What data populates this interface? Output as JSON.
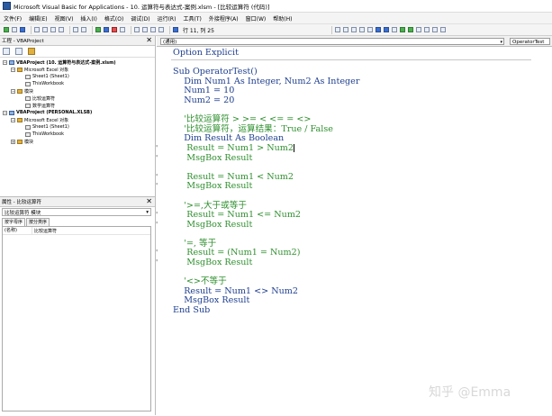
{
  "window": {
    "title": "Microsoft Visual Basic for Applications - 10. 运算符与表达式-案例.xlsm - [比较运算符 (代码)]"
  },
  "menu": [
    "文件(F)",
    "编辑(E)",
    "视图(V)",
    "插入(I)",
    "格式(O)",
    "调试(D)",
    "运行(R)",
    "工具(T)",
    "外接程序(A)",
    "窗口(W)",
    "帮助(H)"
  ],
  "toolbar": {
    "position": "行 11, 列 25"
  },
  "project": {
    "title": "工程 - VBAProject",
    "nodes": [
      {
        "level": 0,
        "box": "−",
        "icon": "proj",
        "label": "VBAProject (10. 运算符与表达式-案例.xlsm)"
      },
      {
        "level": 1,
        "box": "−",
        "icon": "folder",
        "label": "Microsoft Excel 对象"
      },
      {
        "level": 2,
        "box": "",
        "icon": "doc",
        "label": "Sheet1 (Sheet1)"
      },
      {
        "level": 2,
        "box": "",
        "icon": "doc",
        "label": "ThisWorkbook"
      },
      {
        "level": 1,
        "box": "−",
        "icon": "folder",
        "label": "模块"
      },
      {
        "level": 2,
        "box": "",
        "icon": "doc",
        "label": "比较运算符"
      },
      {
        "level": 2,
        "box": "",
        "icon": "doc",
        "label": "数学运算符"
      },
      {
        "level": 0,
        "box": "−",
        "icon": "proj",
        "label": "VBAProject (PERSONAL.XLSB)"
      },
      {
        "level": 1,
        "box": "−",
        "icon": "folder",
        "label": "Microsoft Excel 对象"
      },
      {
        "level": 2,
        "box": "",
        "icon": "doc",
        "label": "Sheet1 (Sheet1)"
      },
      {
        "level": 2,
        "box": "",
        "icon": "doc",
        "label": "ThisWorkbook"
      },
      {
        "level": 1,
        "box": "+",
        "icon": "folder",
        "label": "模块"
      }
    ]
  },
  "properties": {
    "title": "属性 - 比较运算符",
    "selector": "比较运算符 模块",
    "tabs": [
      "按字母序",
      "按分类序"
    ],
    "rows": [
      {
        "key": "(名称)",
        "value": "比较运算符"
      }
    ]
  },
  "code_window": {
    "object_combo": "(通用)",
    "proc_combo": "OperatorTest",
    "lines": [
      {
        "t": "Option Explicit",
        "c": "kw",
        "m": ""
      },
      {
        "t": "",
        "c": "kw",
        "m": ""
      },
      {
        "t": "Sub OperatorTest()",
        "c": "kw",
        "m": ""
      },
      {
        "t": "    Dim Num1 As Integer, Num2 As Integer",
        "c": "kw",
        "m": ""
      },
      {
        "t": "    Num1 = 10",
        "c": "kw",
        "m": ""
      },
      {
        "t": "    Num2 = 20",
        "c": "kw",
        "m": ""
      },
      {
        "t": "",
        "c": "kw",
        "m": ""
      },
      {
        "t": "    '比较运算符 > >= < <= = <>",
        "c": "cm",
        "m": ""
      },
      {
        "t": "    '比较运算符，运算结果：True / False",
        "c": "cm",
        "m": ""
      },
      {
        "t": "    Dim Result As Boolean",
        "c": "kw",
        "m": ""
      },
      {
        "t": "     Result = Num1 > Num2",
        "c": "cm",
        "m": "'"
      },
      {
        "t": "     MsgBox Result",
        "c": "cm",
        "m": "'"
      },
      {
        "t": "",
        "c": "kw",
        "m": ""
      },
      {
        "t": "     Result = Num1 < Num2",
        "c": "cm",
        "m": "'"
      },
      {
        "t": "     MsgBox Result",
        "c": "cm",
        "m": "'"
      },
      {
        "t": "",
        "c": "kw",
        "m": ""
      },
      {
        "t": "    '>=,大于或等于",
        "c": "cm",
        "m": ""
      },
      {
        "t": "     Result = Num1 <= Num2",
        "c": "cm",
        "m": "'"
      },
      {
        "t": "     MsgBox Result",
        "c": "cm",
        "m": "'"
      },
      {
        "t": "",
        "c": "kw",
        "m": ""
      },
      {
        "t": "    '=, 等于",
        "c": "cm",
        "m": ""
      },
      {
        "t": "     Result = (Num1 = Num2)",
        "c": "cm",
        "m": "'"
      },
      {
        "t": "     MsgBox Result",
        "c": "cm",
        "m": "'"
      },
      {
        "t": "",
        "c": "kw",
        "m": ""
      },
      {
        "t": "    '<>不等于",
        "c": "cm",
        "m": ""
      },
      {
        "t": "    Result = Num1 <> Num2",
        "c": "kw",
        "m": ""
      },
      {
        "t": "    MsgBox Result",
        "c": "kw",
        "m": ""
      },
      {
        "t": "End Sub",
        "c": "kw",
        "m": ""
      }
    ]
  },
  "watermark": "知乎 @Emma"
}
